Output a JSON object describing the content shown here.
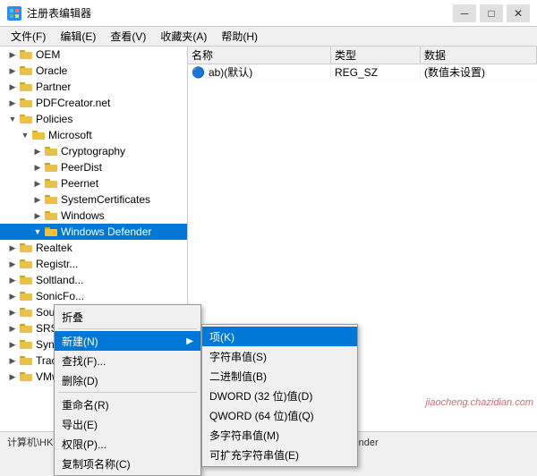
{
  "titlebar": {
    "title": "注册表编辑器",
    "minimize": "─",
    "maximize": "□",
    "close": "✕"
  },
  "menubar": {
    "items": [
      "文件(F)",
      "编辑(E)",
      "查看(V)",
      "收藏夹(A)",
      "帮助(H)"
    ]
  },
  "tree": {
    "items": [
      {
        "label": "OEM",
        "indent": 1,
        "expand": false,
        "hasChildren": true
      },
      {
        "label": "Oracle",
        "indent": 1,
        "expand": false,
        "hasChildren": true
      },
      {
        "label": "Partner",
        "indent": 1,
        "expand": false,
        "hasChildren": true
      },
      {
        "label": "PDFCreator.net",
        "indent": 1,
        "expand": false,
        "hasChildren": true
      },
      {
        "label": "Policies",
        "indent": 1,
        "expand": true,
        "hasChildren": true
      },
      {
        "label": "Microsoft",
        "indent": 2,
        "expand": true,
        "hasChildren": true
      },
      {
        "label": "Cryptography",
        "indent": 3,
        "expand": false,
        "hasChildren": true
      },
      {
        "label": "PeerDist",
        "indent": 3,
        "expand": false,
        "hasChildren": true
      },
      {
        "label": "Peernet",
        "indent": 3,
        "expand": false,
        "hasChildren": true
      },
      {
        "label": "SystemCertificates",
        "indent": 3,
        "expand": false,
        "hasChildren": true
      },
      {
        "label": "Windows",
        "indent": 3,
        "expand": false,
        "hasChildren": true
      },
      {
        "label": "Windows Defender",
        "indent": 3,
        "expand": true,
        "hasChildren": true,
        "selected": true
      },
      {
        "label": "Realtek",
        "indent": 1,
        "expand": false,
        "hasChildren": true
      },
      {
        "label": "Registr...",
        "indent": 1,
        "expand": false,
        "hasChildren": true
      },
      {
        "label": "Soltland...",
        "indent": 1,
        "expand": false,
        "hasChildren": true
      },
      {
        "label": "SonicFo...",
        "indent": 1,
        "expand": false,
        "hasChildren": true
      },
      {
        "label": "SoundRe...",
        "indent": 1,
        "expand": false,
        "hasChildren": true
      },
      {
        "label": "SRS Lab...",
        "indent": 1,
        "expand": false,
        "hasChildren": true
      },
      {
        "label": "Synaptic...",
        "indent": 1,
        "expand": false,
        "hasChildren": true
      },
      {
        "label": "Tracker Software",
        "indent": 1,
        "expand": false,
        "hasChildren": true
      },
      {
        "label": "VMware, Inc.",
        "indent": 1,
        "expand": false,
        "hasChildren": true
      }
    ]
  },
  "right_panel": {
    "headers": [
      "名称",
      "类型",
      "数据"
    ],
    "rows": [
      {
        "name": "ab)(默认)",
        "type": "REG_SZ",
        "data": "(数值未设置)"
      }
    ]
  },
  "context_menu": {
    "items": [
      {
        "label": "折叠",
        "shortcut": "",
        "hasSubmenu": false
      },
      {
        "label": "新建(N)",
        "shortcut": "",
        "hasSubmenu": true,
        "highlighted": true
      },
      {
        "label": "查找(F)...",
        "shortcut": "",
        "hasSubmenu": false
      },
      {
        "label": "删除(D)",
        "shortcut": "",
        "hasSubmenu": false
      },
      {
        "label": "重命名(R)",
        "shortcut": "",
        "hasSubmenu": false
      },
      {
        "label": "导出(E)",
        "shortcut": "",
        "hasSubmenu": false
      },
      {
        "label": "权限(P)...",
        "shortcut": "",
        "hasSubmenu": false
      },
      {
        "label": "复制项名称(C)",
        "shortcut": "",
        "hasSubmenu": false
      }
    ],
    "dividers": [
      1,
      4
    ]
  },
  "submenu": {
    "items": [
      {
        "label": "项(K)",
        "highlighted": true
      },
      {
        "label": "字符串值(S)",
        "highlighted": false
      },
      {
        "label": "二进制值(B)",
        "highlighted": false
      },
      {
        "label": "DWORD (32 位)值(D)",
        "highlighted": false
      },
      {
        "label": "QWORD (64 位)值(Q)",
        "highlighted": false
      },
      {
        "label": "多字符串值(M)",
        "highlighted": false
      },
      {
        "label": "可扩充字符串值(E)",
        "highlighted": false
      }
    ]
  },
  "statusbar": {
    "text": "计算机\\HKEY_LOCAL_MACHINE\\SOFTWARE\\Policies\\Microsoft\\Windows Defender"
  },
  "watermark": {
    "text": "jiaocheng.chazidian.com"
  }
}
